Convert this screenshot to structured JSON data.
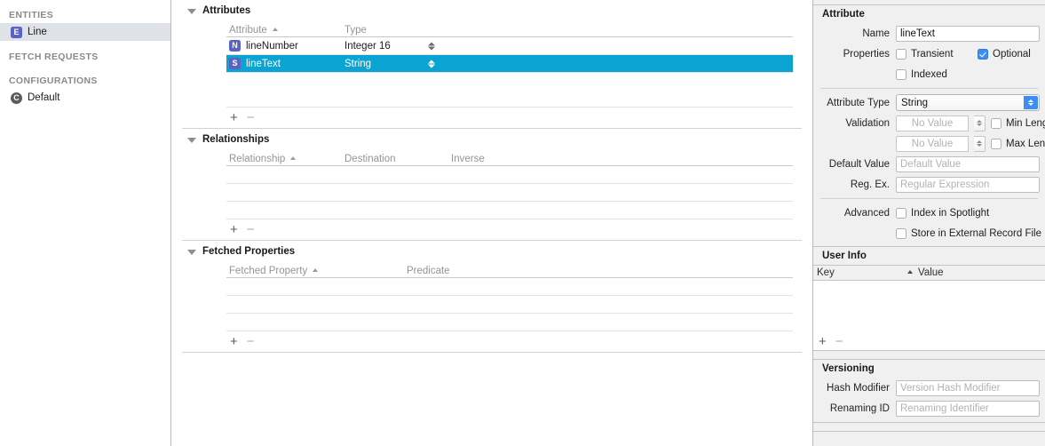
{
  "sidebar": {
    "groups": [
      {
        "title": "ENTITIES",
        "items": [
          {
            "badge": "E",
            "badge_kind": "entity",
            "label": "Line",
            "selected": true
          }
        ]
      },
      {
        "title": "FETCH REQUESTS",
        "items": []
      },
      {
        "title": "CONFIGURATIONS",
        "items": [
          {
            "badge": "C",
            "badge_kind": "config",
            "label": "Default",
            "selected": false
          }
        ]
      }
    ]
  },
  "editor": {
    "attributes": {
      "title": "Attributes",
      "columns": {
        "name": "Attribute",
        "type": "Type"
      },
      "rows": [
        {
          "badge": "N",
          "name": "lineNumber",
          "type": "Integer 16",
          "selected": false
        },
        {
          "badge": "S",
          "name": "lineText",
          "type": "String",
          "selected": true
        }
      ],
      "add_label": "+",
      "remove_label": "−"
    },
    "relationships": {
      "title": "Relationships",
      "columns": {
        "name": "Relationship",
        "destination": "Destination",
        "inverse": "Inverse"
      },
      "rows": [],
      "add_label": "+",
      "remove_label": "−"
    },
    "fetched_properties": {
      "title": "Fetched Properties",
      "columns": {
        "name": "Fetched Property",
        "predicate": "Predicate"
      },
      "rows": [],
      "add_label": "+",
      "remove_label": "−"
    }
  },
  "inspector": {
    "attribute": {
      "title": "Attribute",
      "name_label": "Name",
      "name_value": "lineText",
      "properties_label": "Properties",
      "transient_label": "Transient",
      "transient_checked": false,
      "optional_label": "Optional",
      "optional_checked": true,
      "indexed_label": "Indexed",
      "indexed_checked": false,
      "attribute_type_label": "Attribute Type",
      "attribute_type_value": "String",
      "validation_label": "Validation",
      "min_value": "",
      "min_placeholder": "No Value",
      "min_length_label": "Min Length",
      "min_length_checked": false,
      "max_value": "",
      "max_placeholder": "No Value",
      "max_length_label": "Max Length",
      "max_length_checked": false,
      "default_value_label": "Default Value",
      "default_value": "",
      "default_value_placeholder": "Default Value",
      "regex_label": "Reg. Ex.",
      "regex_value": "",
      "regex_placeholder": "Regular Expression",
      "advanced_label": "Advanced",
      "index_spotlight_label": "Index in Spotlight",
      "index_spotlight_checked": false,
      "store_external_label": "Store in External Record File",
      "store_external_checked": false
    },
    "user_info": {
      "title": "User Info",
      "key_column": "Key",
      "value_column": "Value",
      "rows": [],
      "add_label": "+",
      "remove_label": "−"
    },
    "versioning": {
      "title": "Versioning",
      "hash_modifier_label": "Hash Modifier",
      "hash_modifier_value": "",
      "hash_modifier_placeholder": "Version Hash Modifier",
      "renaming_id_label": "Renaming ID",
      "renaming_id_value": "",
      "renaming_id_placeholder": "Renaming Identifier"
    }
  },
  "colors": {
    "selection": "#0ba3d2",
    "accent_blue": "#3d8ef4",
    "entity_badge": "#5b62c4",
    "sidebar_selection": "#dfe2e6"
  }
}
